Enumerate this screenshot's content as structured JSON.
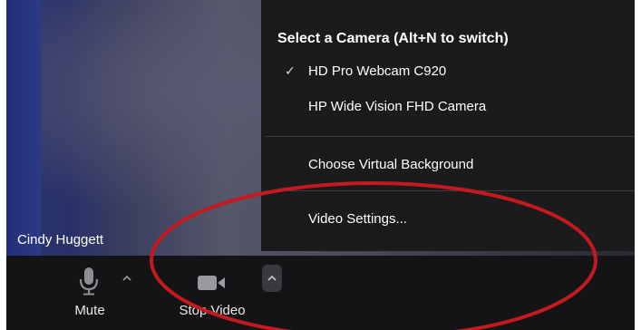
{
  "video": {
    "participant_name": "Cindy Huggett"
  },
  "camera_menu": {
    "title": "Select a Camera (Alt+N to switch)",
    "check_glyph": "✓",
    "items": [
      {
        "label": "HD Pro Webcam C920",
        "selected": true
      },
      {
        "label": "HP Wide Vision FHD Camera",
        "selected": false
      }
    ],
    "virtual_background_label": "Choose Virtual Background",
    "video_settings_label": "Video Settings..."
  },
  "toolbar": {
    "mute_label": "Mute",
    "stop_video_label": "Stop Video",
    "icons": [
      "microphone-icon",
      "chevron-up-icon",
      "video-camera-icon",
      "chevron-up-icon"
    ]
  },
  "colors": {
    "menu_bg": "#1b1b1d",
    "toolbar_bg": "#141416",
    "annotation_red": "#c4191f"
  }
}
